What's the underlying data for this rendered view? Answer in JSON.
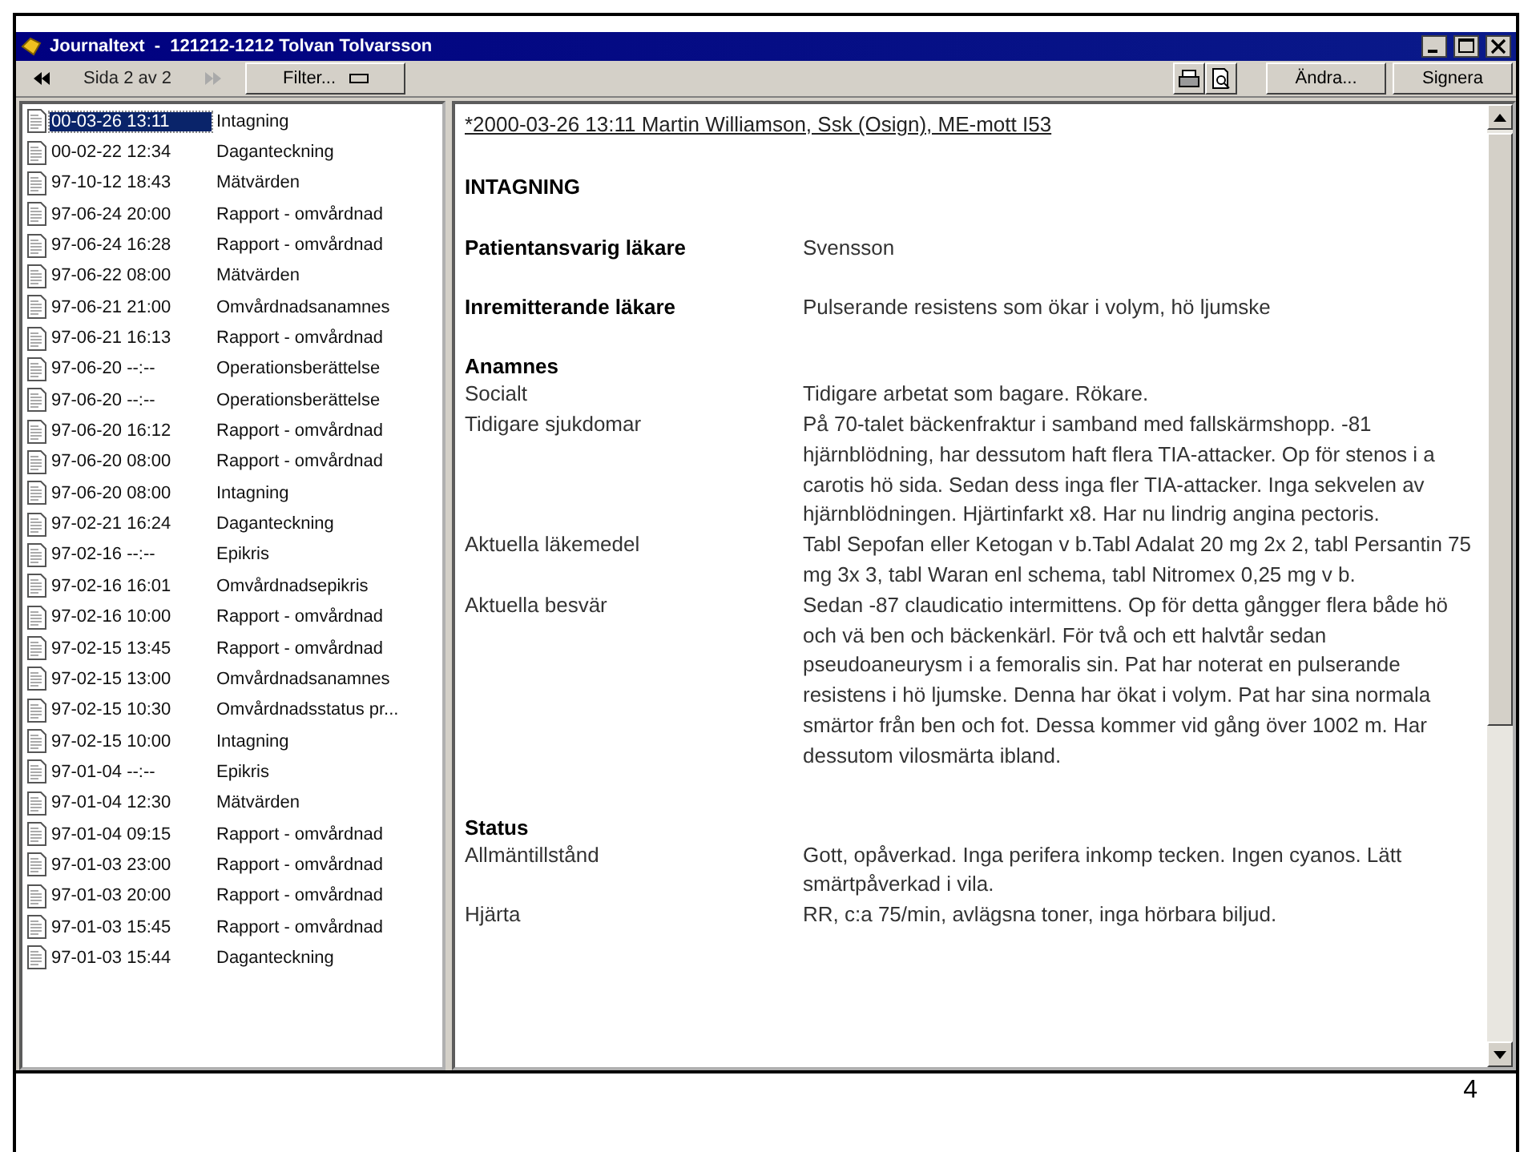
{
  "window": {
    "title": "Journaltext  -  121212-1212 Tolvan Tolvarsson"
  },
  "toolbar": {
    "page_label": "Sida 2 av 2",
    "filter_button": "Filter...",
    "buttons": [
      "Ändra...",
      "Signera"
    ]
  },
  "entries": [
    {
      "date": "00-03-26 13:11",
      "title": "Intagning",
      "selected": true
    },
    {
      "date": "00-02-22 12:34",
      "title": "Daganteckning",
      "selected": false
    },
    {
      "date": "97-10-12 18:43",
      "title": "Mätvärden",
      "selected": false
    },
    {
      "date": "97-06-24 20:00",
      "title": "Rapport - omvårdnad",
      "selected": false
    },
    {
      "date": "97-06-24 16:28",
      "title": "Rapport - omvårdnad",
      "selected": false
    },
    {
      "date": "97-06-22 08:00",
      "title": "Mätvärden",
      "selected": false
    },
    {
      "date": "97-06-21 21:00",
      "title": "Omvårdnadsanamnes",
      "selected": false
    },
    {
      "date": "97-06-21 16:13",
      "title": "Rapport - omvårdnad",
      "selected": false
    },
    {
      "date": "97-06-20 --:--",
      "title": "Operationsberättelse",
      "selected": false
    },
    {
      "date": "97-06-20 --:--",
      "title": "Operationsberättelse",
      "selected": false
    },
    {
      "date": "97-06-20 16:12",
      "title": "Rapport - omvårdnad",
      "selected": false
    },
    {
      "date": "97-06-20 08:00",
      "title": "Rapport - omvårdnad",
      "selected": false
    },
    {
      "date": "97-06-20 08:00",
      "title": "Intagning",
      "selected": false
    },
    {
      "date": "97-02-21 16:24",
      "title": "Daganteckning",
      "selected": false
    },
    {
      "date": "97-02-16 --:--",
      "title": "Epikris",
      "selected": false
    },
    {
      "date": "97-02-16 16:01",
      "title": "Omvårdnadsepikris",
      "selected": false
    },
    {
      "date": "97-02-16 10:00",
      "title": "Rapport - omvårdnad",
      "selected": false
    },
    {
      "date": "97-02-15 13:45",
      "title": "Rapport - omvårdnad",
      "selected": false
    },
    {
      "date": "97-02-15 13:00",
      "title": "Omvårdnadsanamnes",
      "selected": false
    },
    {
      "date": "97-02-15 10:30",
      "title": "Omvårdnadsstatus pr...",
      "selected": false
    },
    {
      "date": "97-02-15 10:00",
      "title": "Intagning",
      "selected": false
    },
    {
      "date": "97-01-04 --:--",
      "title": "Epikris",
      "selected": false
    },
    {
      "date": "97-01-04 12:30",
      "title": "Mätvärden",
      "selected": false
    },
    {
      "date": "97-01-04 09:15",
      "title": "Rapport - omvårdnad",
      "selected": false
    },
    {
      "date": "97-01-03 23:00",
      "title": "Rapport - omvårdnad",
      "selected": false
    },
    {
      "date": "97-01-03 20:00",
      "title": "Rapport - omvårdnad",
      "selected": false
    },
    {
      "date": "97-01-03 15:45",
      "title": "Rapport - omvårdnad",
      "selected": false
    },
    {
      "date": "97-01-03 15:44",
      "title": "Daganteckning",
      "selected": false
    }
  ],
  "document": {
    "header": "*2000-03-26 13:11 Martin Williamson, Ssk (Osign), ME-mott I53",
    "title": "INTAGNING",
    "lead_fields": [
      {
        "label": "Patientansvarig läkare",
        "value": "Svensson"
      },
      {
        "label": "Inremitterande läkare",
        "value": "Pulserande resistens som ökar i volym, hö ljumske"
      }
    ],
    "sections": [
      {
        "title": "Anamnes",
        "rows": [
          {
            "label": "Socialt",
            "value": "Tidigare arbetat som bagare. Rökare."
          },
          {
            "label": "Tidigare sjukdomar",
            "value": "På 70-talet bäckenfraktur i samband med fallskärmshopp. -81 hjärnblödning, har dessutom haft flera TIA-attacker. Op för stenos i a carotis hö sida. Sedan dess inga fler TIA-attacker. Inga sekvelen av hjärnblödningen. Hjärtinfarkt x8. Har nu lindrig angina pectoris."
          },
          {
            "label": "Aktuella läkemedel",
            "value": "Tabl Sepofan eller Ketogan v b.Tabl Adalat 20 mg 2x 2, tabl Persantin 75 mg 3x 3, tabl Waran enl schema, tabl Nitromex 0,25 mg v b."
          },
          {
            "label": "Aktuella besvär",
            "value": "Sedan -87 claudicatio intermittens. Op för detta gångger flera både hö och vä ben och bäckenkärl. För två och ett halvtår sedan pseudoaneurysm i a femoralis sin. Pat har noterat en pulserande resistens i hö ljumske. Denna har ökat i volym. Pat har sina normala smärtor från ben och fot. Dessa kommer vid gång över 1002 m. Har dessutom vilosmärta ibland."
          }
        ]
      },
      {
        "title": "Status",
        "rows": [
          {
            "label": "Allmäntillstånd",
            "value": "Gott, opåverkad. Inga perifera inkomp tecken. Ingen cyanos. Lätt smärtpåverkad i vila."
          },
          {
            "label": "Hjärta",
            "value": "RR, c:a 75/min, avlägsna toner, inga hörbara biljud."
          }
        ]
      }
    ]
  },
  "slide_page_number": "4"
}
